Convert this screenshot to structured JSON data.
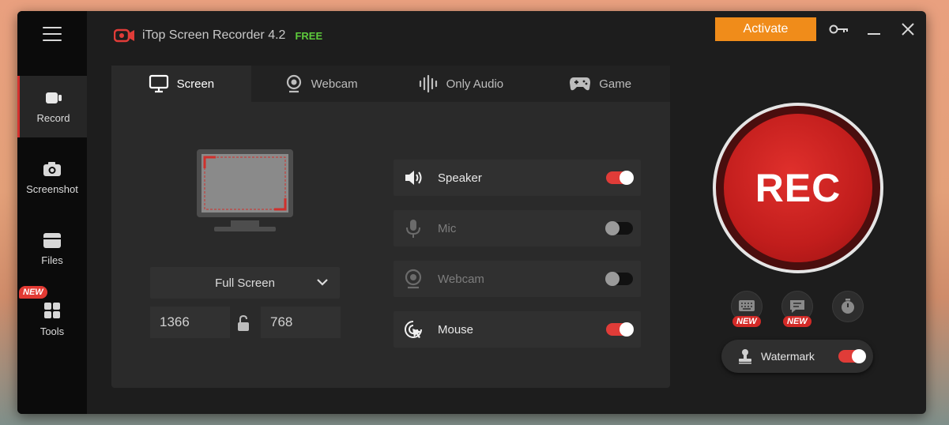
{
  "app": {
    "title": "iTop Screen Recorder 4.2",
    "edition": "FREE",
    "activate_label": "Activate",
    "accent": "#e03c38",
    "activate_color": "#f08c1a"
  },
  "sidebar": {
    "items": [
      {
        "label": "Record",
        "icon": "video-camera-icon",
        "active": true
      },
      {
        "label": "Screenshot",
        "icon": "camera-icon",
        "active": false
      },
      {
        "label": "Files",
        "icon": "folder-icon",
        "active": false
      },
      {
        "label": "Tools",
        "icon": "grid-icon",
        "active": false,
        "badge": "NEW"
      }
    ]
  },
  "tabs": [
    {
      "label": "Screen",
      "icon": "monitor-icon",
      "active": true
    },
    {
      "label": "Webcam",
      "icon": "webcam-icon",
      "active": false
    },
    {
      "label": "Only Audio",
      "icon": "waveform-icon",
      "active": false
    },
    {
      "label": "Game",
      "icon": "gamepad-icon",
      "active": false
    }
  ],
  "capture": {
    "mode": "Full Screen",
    "width": "1366",
    "height": "768"
  },
  "options": [
    {
      "label": "Speaker",
      "icon": "speaker-icon",
      "enabled": true
    },
    {
      "label": "Mic",
      "icon": "microphone-icon",
      "enabled": false
    },
    {
      "label": "Webcam",
      "icon": "webcam-icon",
      "enabled": false
    },
    {
      "label": "Mouse",
      "icon": "mouse-cursor-icon",
      "enabled": true
    }
  ],
  "record": {
    "label": "REC"
  },
  "extras": [
    {
      "icon": "keyboard-icon",
      "badge": "NEW"
    },
    {
      "icon": "chat-icon",
      "badge": "NEW"
    },
    {
      "icon": "timer-icon",
      "badge": ""
    }
  ],
  "watermark": {
    "label": "Watermark",
    "enabled": true
  }
}
